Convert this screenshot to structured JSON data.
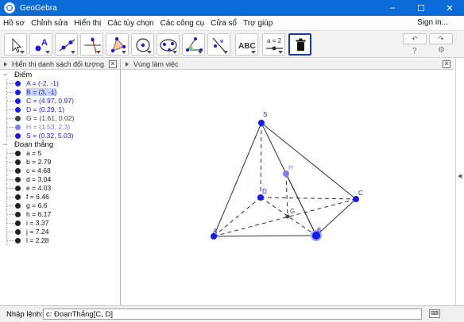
{
  "window": {
    "title": "GeoGebra",
    "controls": {
      "minimize": "–",
      "maximize": "☐",
      "close": "✕"
    }
  },
  "menu": {
    "items": [
      "Hồ sơ",
      "Chỉnh sửa",
      "Hiển thị",
      "Các tùy chọn",
      "Các công cụ",
      "Cửa sổ",
      "Trợ giúp"
    ],
    "signin": "Sign in..."
  },
  "toolbar": {
    "tools": [
      "move-tool",
      "point-tool",
      "line-tool",
      "perpendicular-tool",
      "polygon-tool",
      "circle-tool",
      "ellipse-tool",
      "angle-tool",
      "reflect-tool",
      "text-tool",
      "slider-tool",
      "delete-tool"
    ],
    "text_tool_label": "ABC",
    "slider_tool_label": "a = 2",
    "undo": "↶",
    "redo": "↷",
    "help": "?",
    "settings": "⚙"
  },
  "algebra": {
    "title": "Hiển thị danh sách đối tượng",
    "close": "✕",
    "groups": [
      {
        "name": "Điểm",
        "items": [
          {
            "label": "A = (-2, -1)",
            "color": "#1a1ae6",
            "text_color": "#1a1ae6",
            "selected": false
          },
          {
            "label": "B = (3, -1)",
            "color": "#1a1ae6",
            "text_color": "#1a1ae6",
            "selected": true
          },
          {
            "label": "C = (4.97, 0.97)",
            "color": "#1a1ae6",
            "text_color": "#1a1ae6",
            "selected": false
          },
          {
            "label": "D = (0.29, 1)",
            "color": "#1a1ae6",
            "text_color": "#1a1ae6",
            "selected": false
          },
          {
            "label": "G = (1.61, 0.02)",
            "color": "#444444",
            "text_color": "#444444",
            "selected": false
          },
          {
            "label": "H = (1.53, 2.3)",
            "color": "#7d7df0",
            "text_color": "#7d7df0",
            "selected": false
          },
          {
            "label": "S = (0.32, 5.03)",
            "color": "#1a1ae6",
            "text_color": "#1a1ae6",
            "selected": false
          }
        ]
      },
      {
        "name": "Đoạn thẳng",
        "items": [
          {
            "label": "a = 5",
            "color": "#222222",
            "text_color": "#111111",
            "selected": false
          },
          {
            "label": "b = 2.79",
            "color": "#222222",
            "text_color": "#111111",
            "selected": false
          },
          {
            "label": "c = 4.68",
            "color": "#222222",
            "text_color": "#111111",
            "selected": false
          },
          {
            "label": "d = 3.04",
            "color": "#222222",
            "text_color": "#111111",
            "selected": false
          },
          {
            "label": "e = 4.03",
            "color": "#222222",
            "text_color": "#111111",
            "selected": false
          },
          {
            "label": "f = 6.46",
            "color": "#222222",
            "text_color": "#111111",
            "selected": false
          },
          {
            "label": "g = 6.6",
            "color": "#222222",
            "text_color": "#111111",
            "selected": false
          },
          {
            "label": "h = 6.17",
            "color": "#222222",
            "text_color": "#111111",
            "selected": false
          },
          {
            "label": "i = 3.37",
            "color": "#222222",
            "text_color": "#111111",
            "selected": false
          },
          {
            "label": "j = 7.24",
            "color": "#222222",
            "text_color": "#111111",
            "selected": false
          },
          {
            "label": "l = 2.28",
            "color": "#222222",
            "text_color": "#111111",
            "selected": false
          }
        ]
      }
    ]
  },
  "graphics": {
    "title": "Vùng làm việc",
    "point_labels": {
      "S": "S",
      "A": "A",
      "B": "B",
      "C": "C",
      "D": "D",
      "G": "G",
      "H": "H"
    },
    "point_color": "#1a1ae6",
    "hidden_point_color": "#7d7df0"
  },
  "inputbar": {
    "label": "Nhập lệnh:",
    "value": "c: ĐoạnThẳng[C, D]",
    "keyboard": "⌨"
  }
}
